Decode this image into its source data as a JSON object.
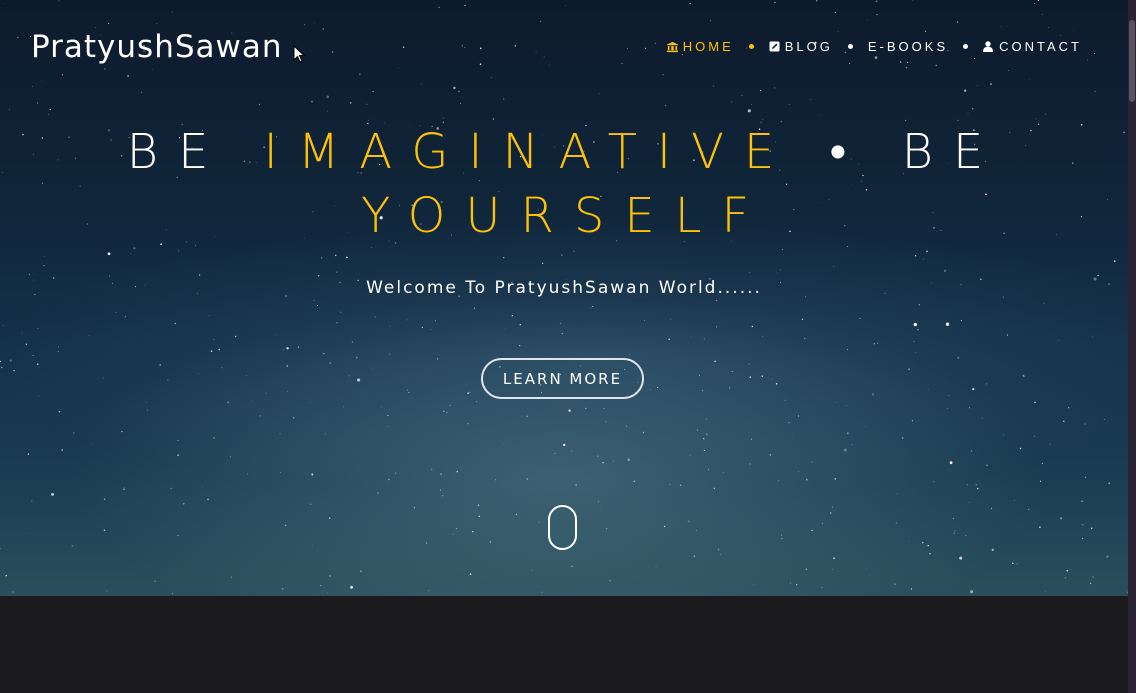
{
  "brand": {
    "name": "PratyushSawan"
  },
  "nav": {
    "items": [
      {
        "label": "HOME",
        "icon": "bank-icon",
        "active": true
      },
      {
        "label": "BLOG",
        "icon": "edit-icon",
        "active": false
      },
      {
        "label": "E-BOOKS",
        "icon": "",
        "active": false
      },
      {
        "label": "CONTACT",
        "icon": "user-icon",
        "active": false
      }
    ]
  },
  "hero": {
    "headline_part1": "BE",
    "headline_accent1": "IMAGINATIVE",
    "headline_separator": "•",
    "headline_part2": "BE",
    "headline_accent2": "YOURSELF",
    "subtitle": "Welcome To PratyushSawan World......",
    "cta_label": "LEARN MORE"
  },
  "colors": {
    "accent": "#ffc107",
    "text": "#ffffff",
    "dark_bg": "#1b1b1d"
  }
}
